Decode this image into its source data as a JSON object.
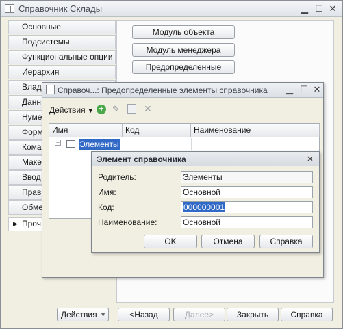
{
  "window": {
    "title": "Справочник Склады"
  },
  "tabs": [
    {
      "label": "Основные"
    },
    {
      "label": "Подсистемы"
    },
    {
      "label": "Функциональные опции"
    },
    {
      "label": "Иерархия"
    },
    {
      "label": "Влад"
    },
    {
      "label": "Данн"
    },
    {
      "label": "Нуме"
    },
    {
      "label": "Форм"
    },
    {
      "label": "Кома"
    },
    {
      "label": "Маке"
    },
    {
      "label": "Ввод"
    },
    {
      "label": "Прав"
    },
    {
      "label": "Обме"
    },
    {
      "label": "Проч"
    }
  ],
  "panel_buttons": {
    "object_module": "Модуль объекта",
    "manager_module": "Модуль менеджера",
    "predefined": "Предопределенные"
  },
  "bottom": {
    "actions": "Действия",
    "back": "<Назад",
    "next": "Далее>",
    "close": "Закрыть",
    "help": "Справка"
  },
  "dialog_predefined": {
    "title": "Справоч...: Предопределенные элементы справочника",
    "toolbar": {
      "actions": "Действия"
    },
    "columns": [
      "Имя",
      "Код",
      "Наименование"
    ],
    "rows": [
      {
        "name": "Элементы",
        "code": "",
        "description": ""
      }
    ]
  },
  "dialog_element": {
    "title": "Элемент справочника",
    "fields": {
      "parent_label": "Родитель:",
      "parent_value": "Элементы",
      "name_label": "Имя:",
      "name_value": "Основной",
      "code_label": "Код:",
      "code_value": "000000001",
      "description_label": "Наименование:",
      "description_value": "Основной"
    },
    "buttons": {
      "ok": "OK",
      "cancel": "Отмена",
      "help": "Справка"
    }
  }
}
